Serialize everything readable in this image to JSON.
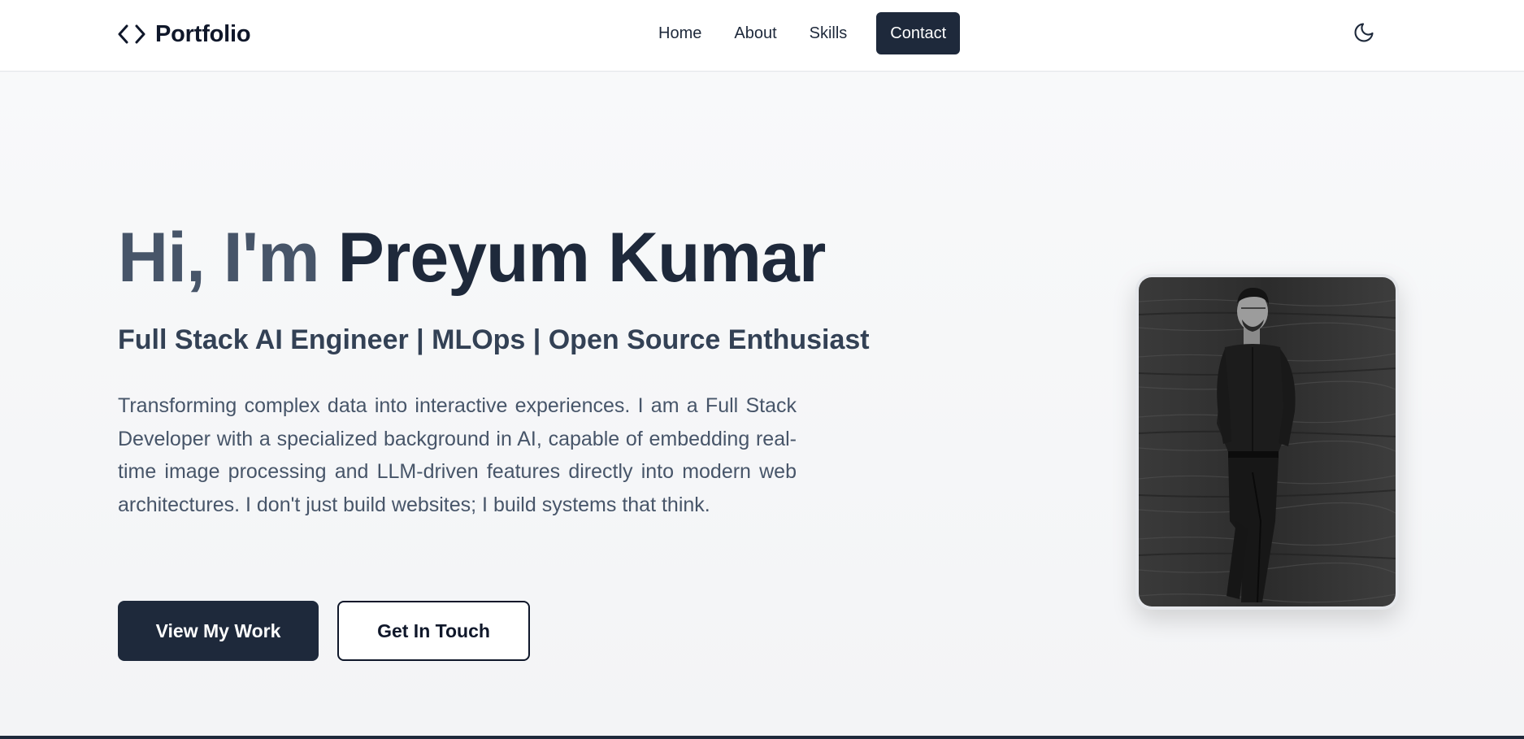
{
  "nav": {
    "brand": "Portfolio",
    "brand_icon": "code-brackets-icon",
    "links": [
      {
        "label": "Home"
      },
      {
        "label": "About"
      },
      {
        "label": "Skills"
      },
      {
        "label": "Contact",
        "active": true
      }
    ],
    "theme_icon": "moon-icon"
  },
  "hero": {
    "greeting": "Hi, I'm",
    "name": "Preyum Kumar",
    "subtitle": "Full Stack AI Engineer | MLOps | Open Source Enthusiast",
    "description": "Transforming complex data into interactive experiences. I am a Full Stack Developer with a specialized background in AI, capable of embedding real-time image processing and LLM-driven features directly into modern web architectures. I don't just build websites; I build systems that think.",
    "primary_button": "View My Work",
    "secondary_button": "Get In Touch",
    "photo": "profile-photo"
  },
  "colors": {
    "primary": "#1e293b",
    "greeting": "#475569",
    "background": "#f4f5f7"
  }
}
